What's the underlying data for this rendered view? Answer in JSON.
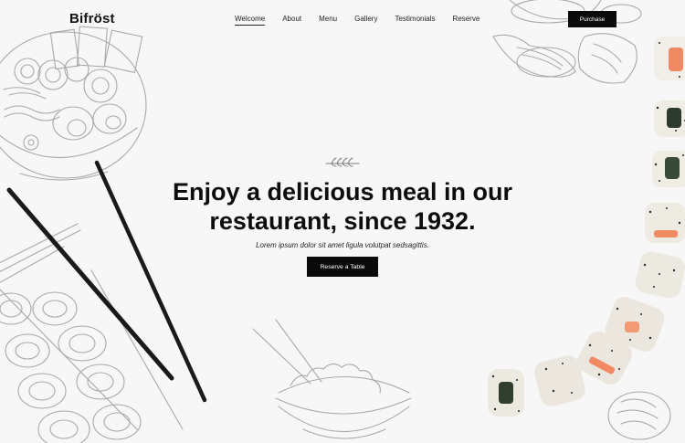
{
  "header": {
    "logo": "Bifröst",
    "nav": [
      {
        "label": "Welcome",
        "active": true
      },
      {
        "label": "About"
      },
      {
        "label": "Menu"
      },
      {
        "label": "Gallery"
      },
      {
        "label": "Testimonials"
      },
      {
        "label": "Reserve"
      }
    ],
    "purchase_label": "Purchase"
  },
  "hero": {
    "title_line1": "Enjoy a delicious meal in our",
    "title_line2": "restaurant, since 1932.",
    "subtitle": "Lorem ipsum dolor sit amet ligula volutpat sedsagittis.",
    "cta_label": "Reserve a Table"
  },
  "colors": {
    "background": "#f7f7f7",
    "button_bg": "#0a0a0a",
    "sketch_stroke": "#a9a9a9"
  }
}
